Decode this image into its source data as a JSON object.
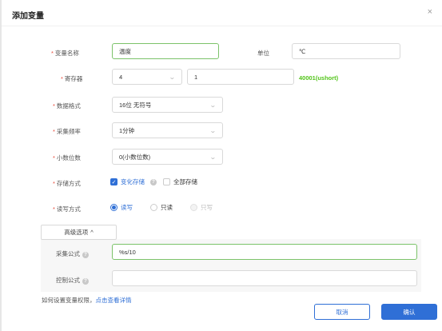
{
  "dialog": {
    "title": "添加变量",
    "close_icon": "×"
  },
  "form": {
    "name": {
      "label": "变量名称",
      "value": "温度"
    },
    "unit": {
      "label": "单位",
      "value": "℃"
    },
    "register": {
      "label": "寄存器",
      "type_value": "4",
      "address_value": "1",
      "hint": "40001(ushort)"
    },
    "data_format": {
      "label": "数据格式",
      "value": "16位 无符号"
    },
    "sample_rate": {
      "label": "采集频率",
      "value": "1分钟"
    },
    "decimals": {
      "label": "小数位数",
      "value": "0(小数位数)"
    },
    "storage": {
      "label": "存储方式",
      "options": [
        {
          "label": "变化存储",
          "checked": true
        },
        {
          "label": "全部存储",
          "checked": false
        }
      ]
    },
    "rw_mode": {
      "label": "读写方式",
      "options": [
        {
          "label": "读写",
          "checked": true
        },
        {
          "label": "只读",
          "checked": false
        },
        {
          "label": "只写",
          "checked": false,
          "disabled": true
        }
      ]
    }
  },
  "advanced": {
    "toggle_label": "高级选项",
    "collect_formula": {
      "label": "采集公式",
      "value": "%s/10"
    },
    "control_formula": {
      "label": "控制公式",
      "value": ""
    }
  },
  "footer": {
    "help_text": "如何设置变量权限，",
    "help_link": "点击查看详情",
    "cancel_label": "取消",
    "ok_label": "确认"
  },
  "colors": {
    "primary": "#2f6fd6",
    "success": "#52c41a",
    "required": "#e74c3c",
    "active_border": "#7cc36a"
  }
}
